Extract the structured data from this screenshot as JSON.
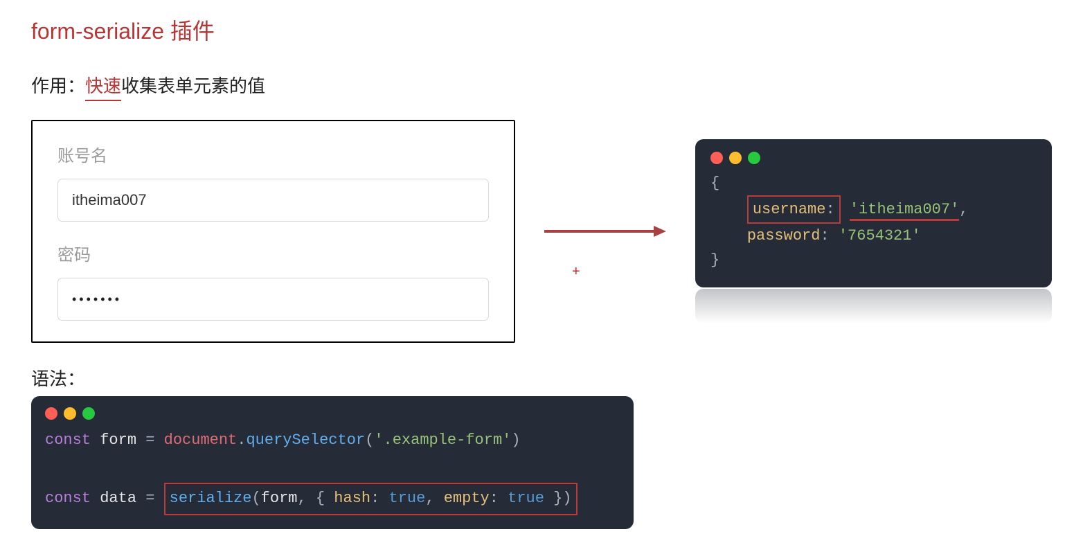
{
  "title": "form-serialize 插件",
  "description_prefix": "作用：",
  "description_fast": "快速",
  "description_suffix": "收集表单元素的值",
  "form": {
    "username_label": "账号名",
    "username_value": "itheima007",
    "password_label": "密码",
    "password_value": "•••••••"
  },
  "arrow_glyph": "⟶",
  "plus_glyph": "+",
  "output": {
    "open": "{",
    "close": "}",
    "username_key": "username",
    "username_val": "'itheima007'",
    "password_key": "password",
    "password_val": "'7654321'",
    "colon": ":",
    "comma": ","
  },
  "syntax_label": "语法：",
  "syntax": {
    "kw_const": "const",
    "var_form": "form",
    "eq": "=",
    "obj_document": "document",
    "dot": ".",
    "fn_qs": "querySelector",
    "lp": "(",
    "rp": ")",
    "selector": "'.example-form'",
    "var_data": "data",
    "fn_serialize": "serialize",
    "arg_form": "form",
    "lb": "{",
    "rb": "}",
    "prop_hash": "hash",
    "prop_empty": "empty",
    "colon": ":",
    "true": "true",
    "comma": ","
  }
}
